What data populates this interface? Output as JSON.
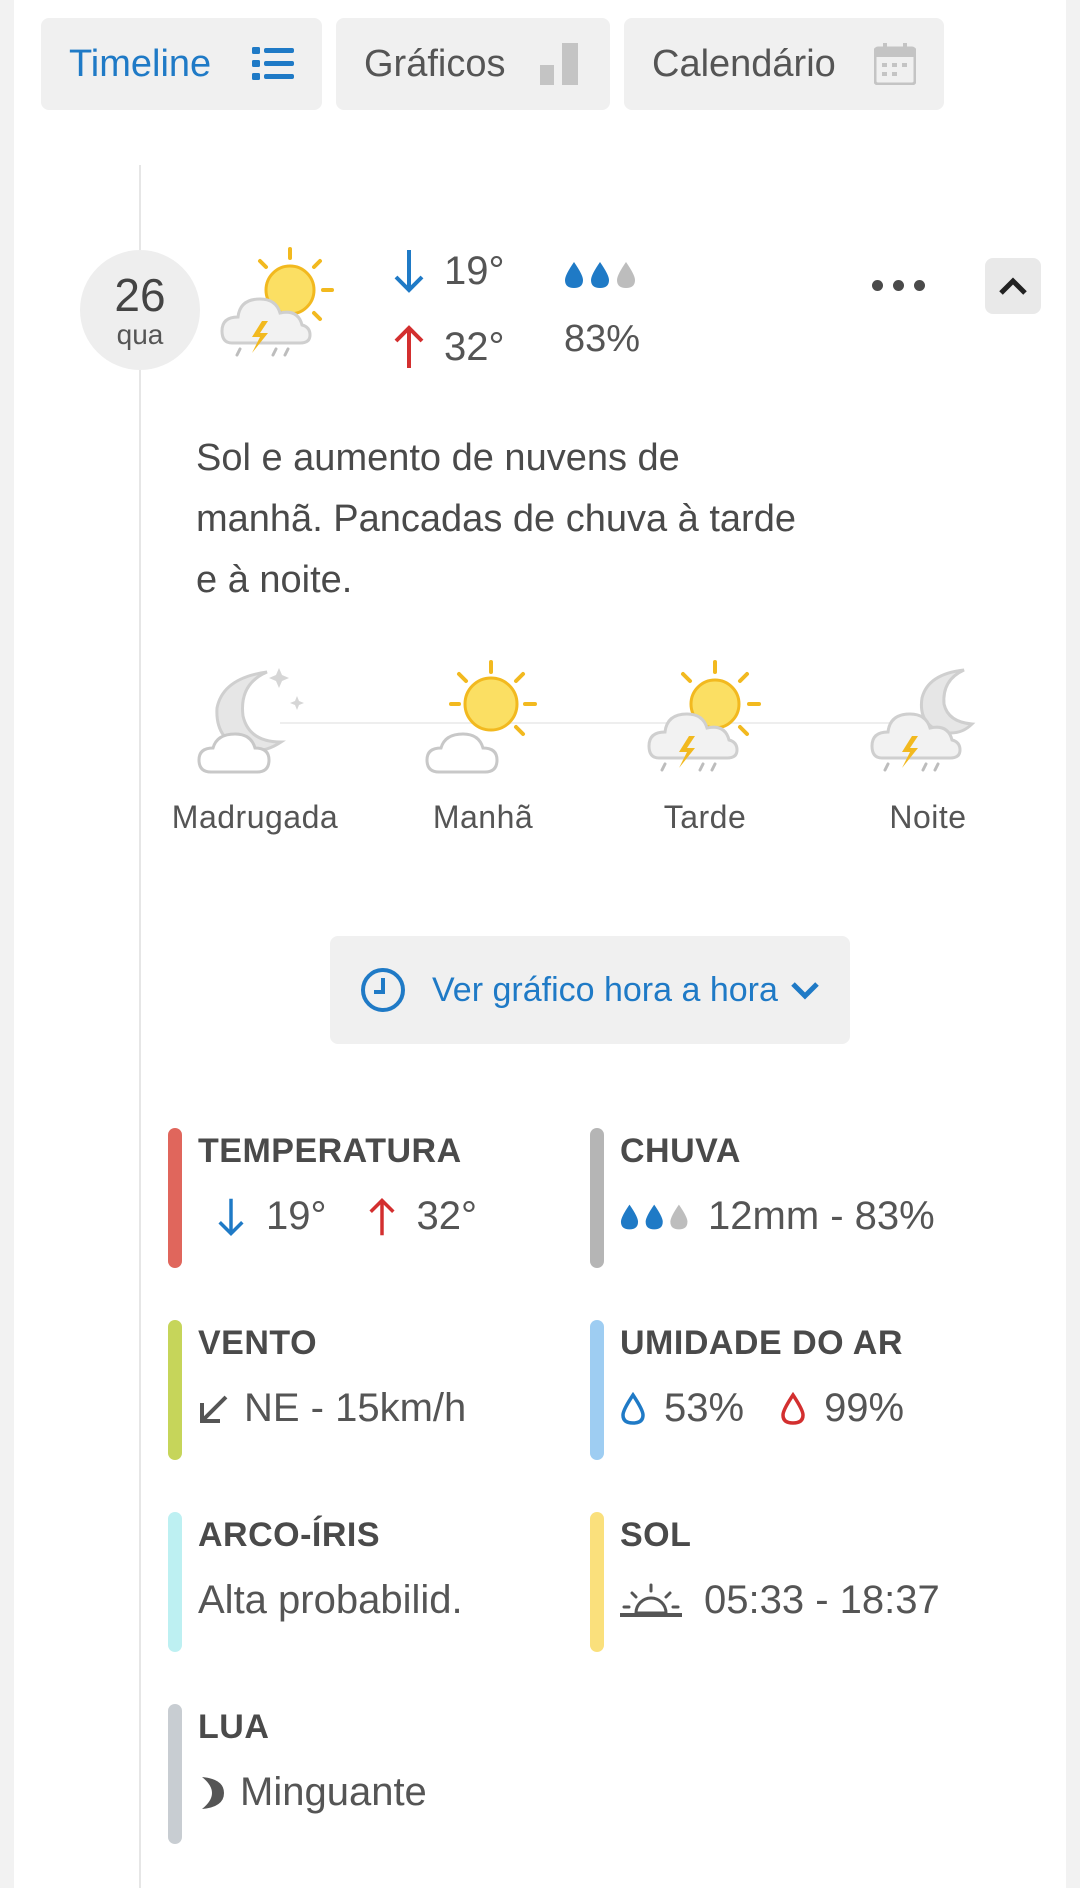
{
  "tabs": [
    {
      "label": "Timeline",
      "icon": "list-icon",
      "active": true
    },
    {
      "label": "Gráficos",
      "icon": "bar-chart-icon",
      "active": false
    },
    {
      "label": "Calendário",
      "icon": "calendar-icon",
      "active": false
    }
  ],
  "day": {
    "date": "26",
    "weekday": "qua",
    "min_temp": "19°",
    "max_temp": "32°",
    "rain_prob": "83%",
    "description": "Sol e aumento de nuvens de manhã. Pancadas de chuva à tarde e à noite."
  },
  "periods": [
    {
      "label": "Madrugada",
      "icon": "moon-cloud-icon"
    },
    {
      "label": "Manhã",
      "icon": "sun-cloud-icon"
    },
    {
      "label": "Tarde",
      "icon": "sun-storm-icon"
    },
    {
      "label": "Noite",
      "icon": "moon-storm-icon"
    }
  ],
  "hourly_button": {
    "label": "Ver gráfico hora a hora"
  },
  "stats": {
    "temperature": {
      "title": "TEMPERATURA",
      "min": "19°",
      "max": "32°"
    },
    "rain": {
      "title": "CHUVA",
      "value": "12mm - 83%"
    },
    "wind": {
      "title": "VENTO",
      "value": "NE - 15km/h"
    },
    "humidity": {
      "title": "UMIDADE DO AR",
      "min": "53%",
      "max": "99%"
    },
    "rainbow": {
      "title": "ARCO-ÍRIS",
      "value": "Alta probabilid."
    },
    "sun": {
      "title": "SOL",
      "value": "05:33 - 18:37"
    },
    "moon": {
      "title": "LUA",
      "value": "Minguante"
    }
  },
  "colors": {
    "accent": "#1f7ac6",
    "down_arrow": "#1f7ac6",
    "up_arrow": "#d32f2f",
    "temperature_bar": "#e0665c",
    "rain_bar": "#b5b5b5",
    "wind_bar": "#c6d55a",
    "humidity_bar": "#9ecdf2",
    "rainbow_bar": "#bdf0f2",
    "sun_bar": "#fae07c",
    "moon_bar": "#c8cdd2"
  }
}
